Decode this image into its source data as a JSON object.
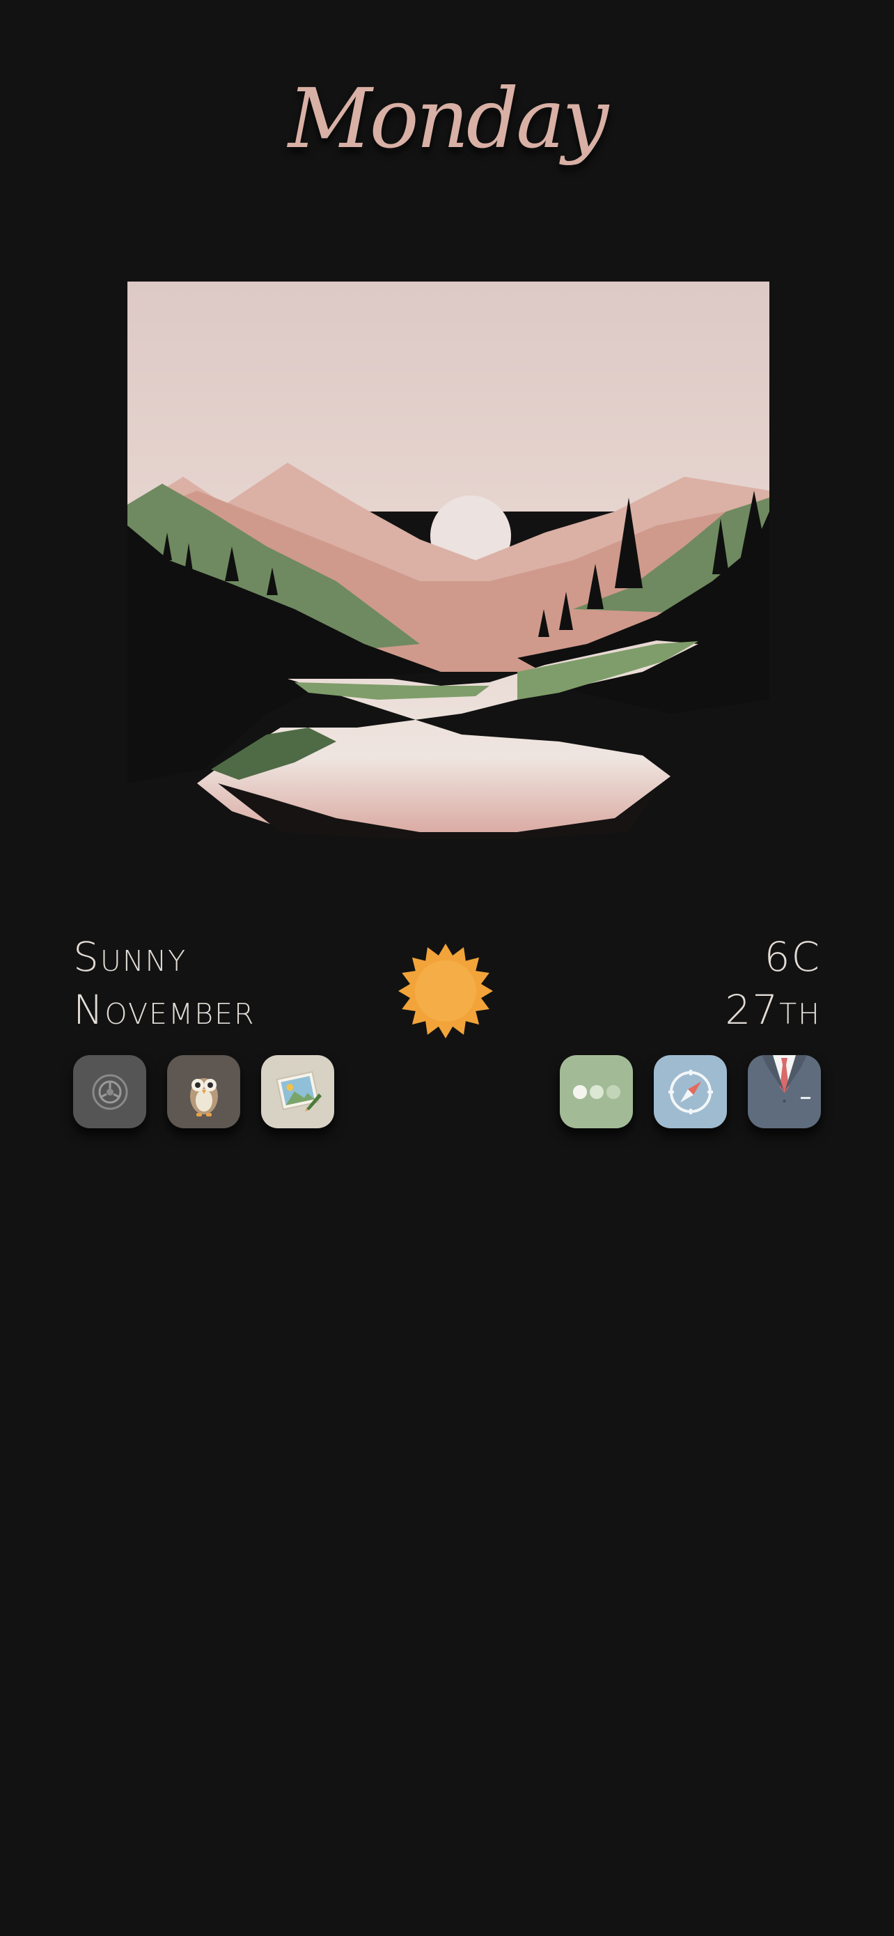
{
  "header": {
    "day": "Monday"
  },
  "weather": {
    "condition": "Sunny",
    "month": "November",
    "temperature": "6C",
    "date": "27th",
    "icon": "sun-icon"
  },
  "dock_left": [
    {
      "icon": "settings-icon",
      "bg": "#555555"
    },
    {
      "icon": "owl-icon",
      "bg": "#5e5752"
    },
    {
      "icon": "photos-icon",
      "bg": "#d8d2c4"
    }
  ],
  "dock_right": [
    {
      "icon": "messages-icon",
      "bg": "#a2bb96"
    },
    {
      "icon": "safari-compass-icon",
      "bg": "#9fbbd0"
    },
    {
      "icon": "suit-icon",
      "bg": "#5f6c7d"
    }
  ],
  "colors": {
    "background": "#121212",
    "accent": "#d9b0a5",
    "text": "#e2dcd6",
    "sun": "#f2a43a"
  }
}
